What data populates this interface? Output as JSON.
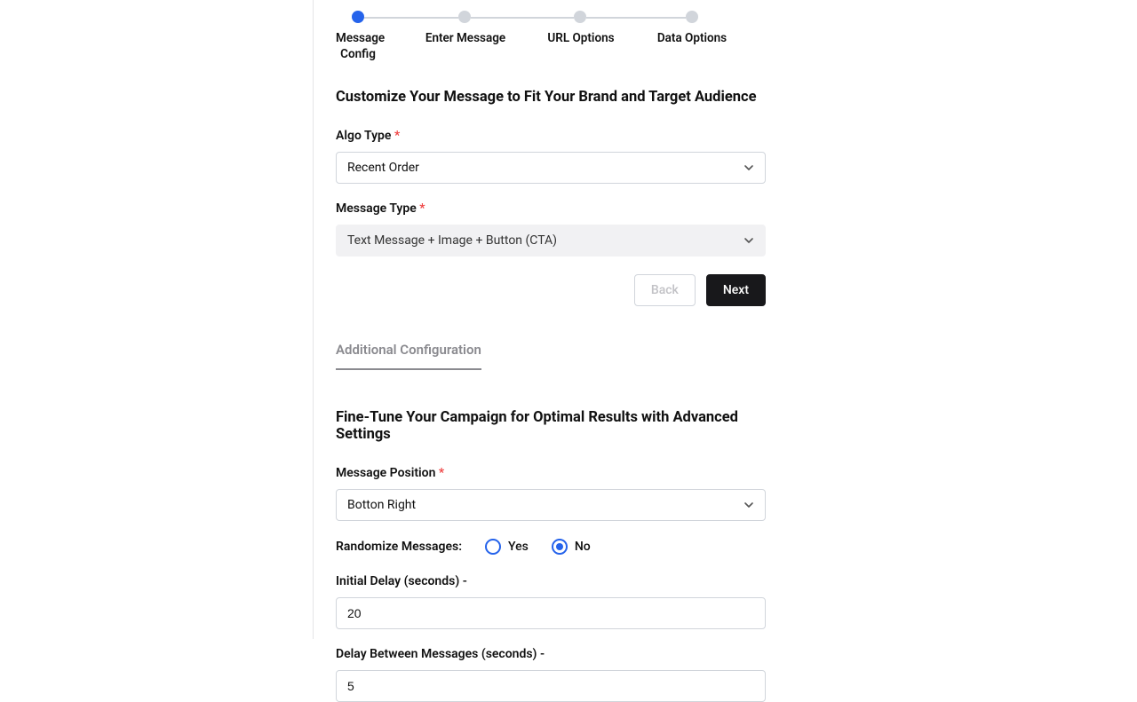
{
  "stepper": {
    "steps": [
      {
        "label": "Message\nConfig",
        "active": true
      },
      {
        "label": "Enter Message",
        "active": false
      },
      {
        "label": "URL Options",
        "active": false
      },
      {
        "label": "Data Options",
        "active": false
      }
    ]
  },
  "section1": {
    "title": "Customize Your Message to Fit Your Brand and Target Audience",
    "algo_label": "Algo Type",
    "algo_value": "Recent Order",
    "msgtype_label": "Message Type",
    "msgtype_value": "Text Message + Image + Button (CTA)"
  },
  "buttons": {
    "back": "Back",
    "next": "Next"
  },
  "section2": {
    "tab": "Additional Configuration",
    "title": "Fine-Tune Your Campaign for Optimal Results with Advanced Settings",
    "position_label": "Message Position",
    "position_value": "Botton Right",
    "randomize_label": "Randomize Messages:",
    "yes": "Yes",
    "no": "No",
    "initial_delay_label": "Initial Delay (seconds) -",
    "initial_delay_value": "20",
    "between_delay_label": "Delay Between Messages (seconds) -",
    "between_delay_value": "5"
  }
}
